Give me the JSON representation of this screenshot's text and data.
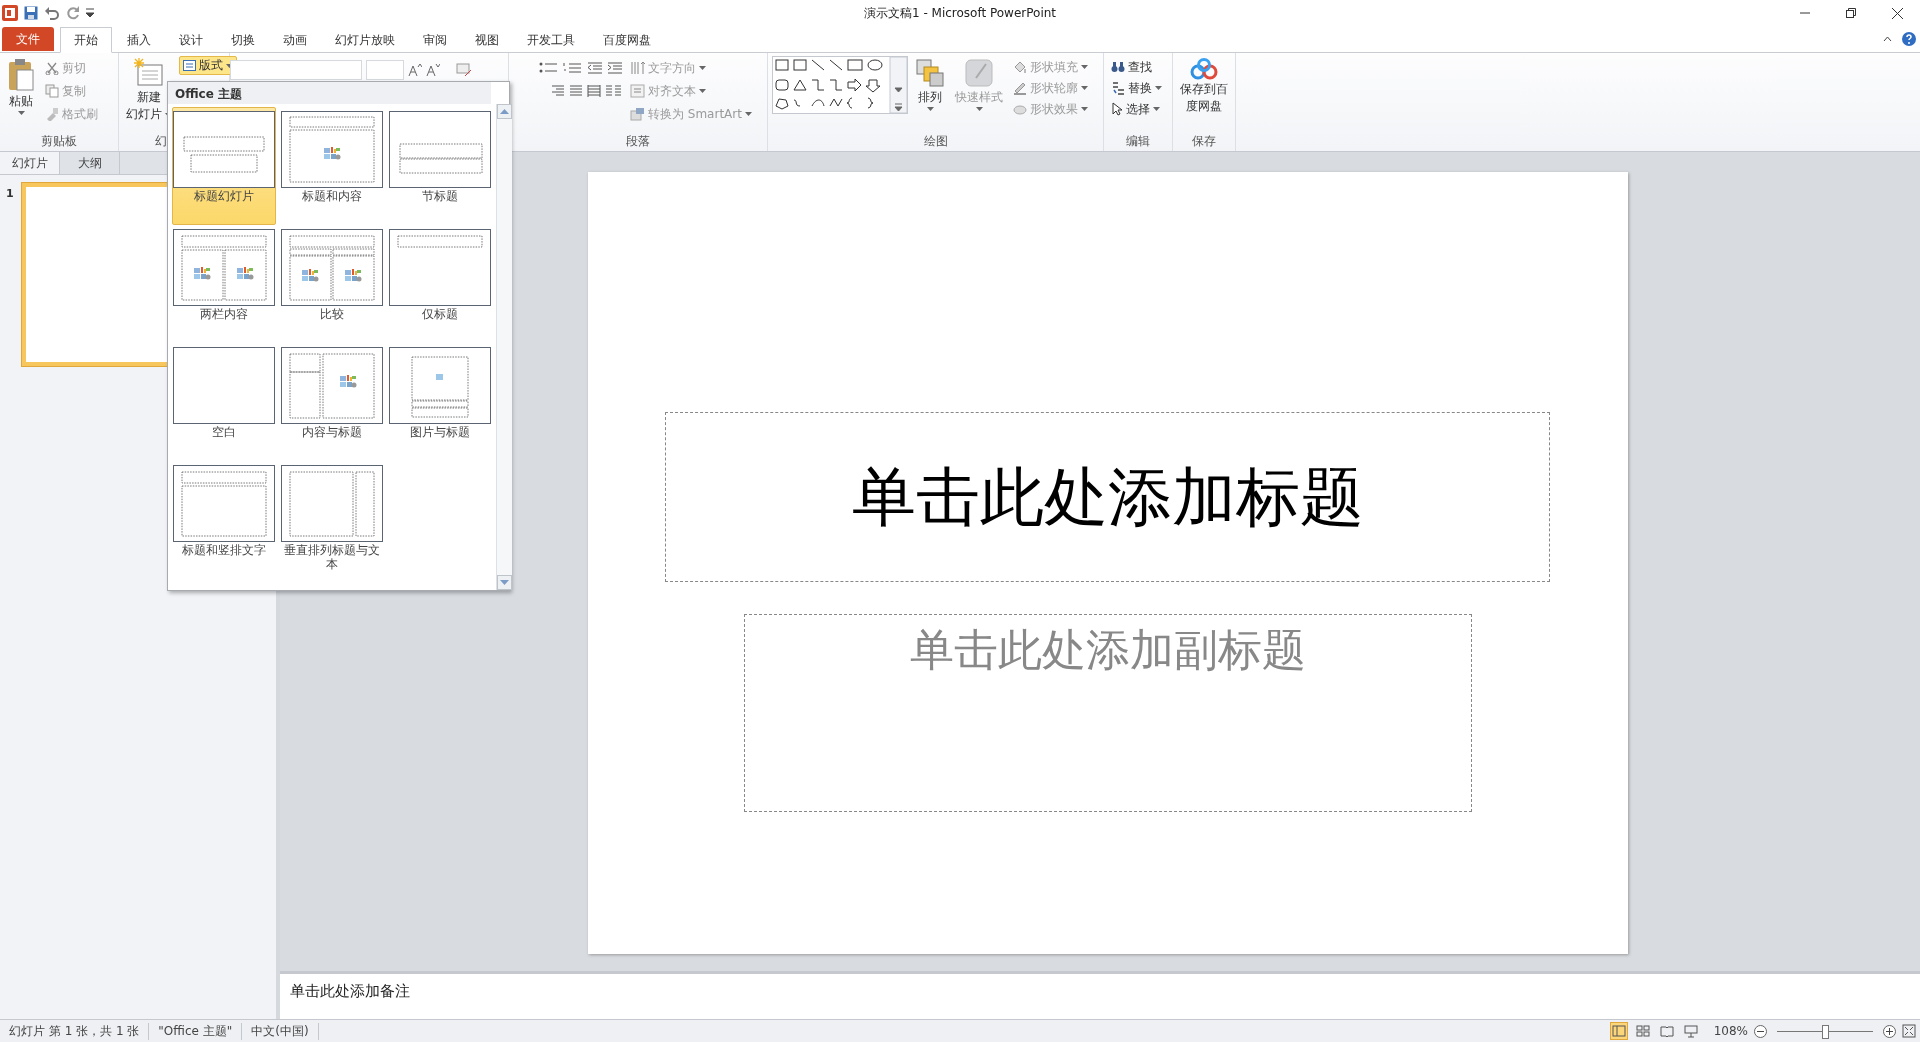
{
  "window": {
    "title": "演示文稿1 - Microsoft PowerPoint"
  },
  "ribbon_tabs": [
    {
      "label": "文件",
      "selected": false,
      "kind": "file"
    },
    {
      "label": "开始",
      "selected": true,
      "kind": "tab"
    },
    {
      "label": "插入",
      "selected": false,
      "kind": "tab"
    },
    {
      "label": "设计",
      "selected": false,
      "kind": "tab"
    },
    {
      "label": "切换",
      "selected": false,
      "kind": "tab"
    },
    {
      "label": "动画",
      "selected": false,
      "kind": "tab"
    },
    {
      "label": "幻灯片放映",
      "selected": false,
      "kind": "tab"
    },
    {
      "label": "审阅",
      "selected": false,
      "kind": "tab"
    },
    {
      "label": "视图",
      "selected": false,
      "kind": "tab"
    },
    {
      "label": "开发工具",
      "selected": false,
      "kind": "tab"
    },
    {
      "label": "百度网盘",
      "selected": false,
      "kind": "tab"
    }
  ],
  "clipboard": {
    "paste": "粘贴",
    "items": [
      {
        "label": "剪切",
        "disabled": true
      },
      {
        "label": "复制",
        "disabled": true
      },
      {
        "label": "格式刷",
        "disabled": true
      }
    ],
    "group_label": "剪贴板"
  },
  "slides_group": {
    "new_slide": "新建",
    "new_slide_2": "幻灯片",
    "layout_button": {
      "label": "版式",
      "expanded": true
    },
    "group_label": "幻"
  },
  "paragraph": {
    "items": [
      {
        "label": "文字方向",
        "disabled": true
      },
      {
        "label": "对齐文本",
        "disabled": true
      },
      {
        "label": "转换为 SmartArt",
        "disabled": true
      }
    ],
    "group_label": "段落"
  },
  "drawing": {
    "arrange": "排列",
    "quick_styles": {
      "label": "快速样式",
      "disabled": true
    },
    "items": [
      {
        "label": "形状填充",
        "disabled": true
      },
      {
        "label": "形状轮廓",
        "disabled": true
      },
      {
        "label": "形状效果",
        "disabled": true
      }
    ],
    "group_label": "绘图"
  },
  "editing": {
    "items": [
      {
        "label": "查找",
        "kind": "find"
      },
      {
        "label": "替换",
        "kind": "replace"
      },
      {
        "label": "选择",
        "kind": "select"
      }
    ],
    "group_label": "编辑"
  },
  "save_group": {
    "button_line_1": "保存到百",
    "button_line_2": "度网盘",
    "group_label": "保存"
  },
  "pane_tabs": [
    {
      "label": "幻灯片",
      "selected": true
    },
    {
      "label": "大纲",
      "selected": false
    }
  ],
  "slide_thumbnails": [
    {
      "number": "1",
      "selected": true
    }
  ],
  "layout_gallery": {
    "title": "Office 主题",
    "layouts": [
      {
        "label": "标题幻灯片",
        "selected": true,
        "kind": "title"
      },
      {
        "label": "标题和内容",
        "selected": false,
        "kind": "title_content"
      },
      {
        "label": "节标题",
        "selected": false,
        "kind": "section"
      },
      {
        "label": "两栏内容",
        "selected": false,
        "kind": "two_content"
      },
      {
        "label": "比较",
        "selected": false,
        "kind": "comparison"
      },
      {
        "label": "仅标题",
        "selected": false,
        "kind": "title_only"
      },
      {
        "label": "空白",
        "selected": false,
        "kind": "blank"
      },
      {
        "label": "内容与标题",
        "selected": false,
        "kind": "content_caption"
      },
      {
        "label": "图片与标题",
        "selected": false,
        "kind": "picture_caption"
      },
      {
        "label": "标题和竖排文字",
        "selected": false,
        "kind": "vertical_text"
      },
      {
        "label": "垂直排列标题与文本",
        "selected": false,
        "kind": "vertical_title"
      }
    ]
  },
  "slide": {
    "title_placeholder": "单击此处添加标题",
    "subtitle_placeholder": "单击此处添加副标题"
  },
  "notes": {
    "placeholder": "单击此处添加备注"
  },
  "status_bar": {
    "slide_info": "幻灯片 第 1 张，共 1 张",
    "theme": "\"Office 主题\"",
    "language": "中文(中国)",
    "views": [
      {
        "kind": "normal",
        "selected": true
      },
      {
        "kind": "sorter",
        "selected": false
      },
      {
        "kind": "reading",
        "selected": false
      },
      {
        "kind": "show",
        "selected": false
      }
    ],
    "zoom": "108%",
    "zoom_slider": {
      "level": 0.5
    }
  }
}
